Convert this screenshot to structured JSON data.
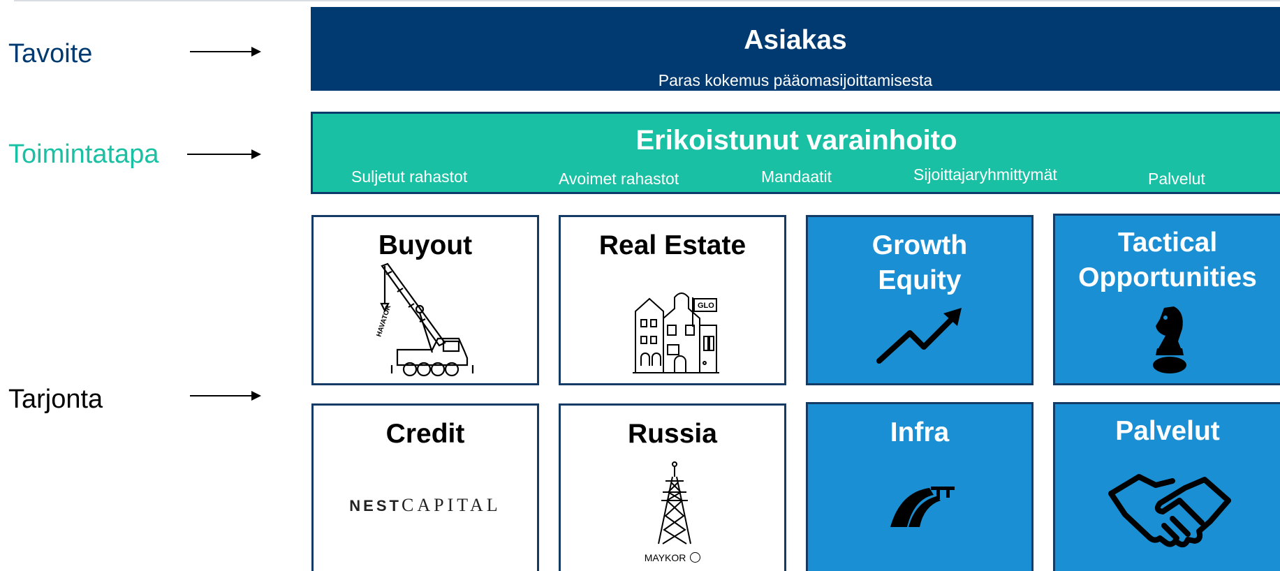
{
  "labels": {
    "tavoite": "Tavoite",
    "toimintatapa": "Toimintatapa",
    "tarjonta": "Tarjonta"
  },
  "colors": {
    "navy": "#003a70",
    "teal": "#19c0a3",
    "blue": "#1b8fd3",
    "border": "#143b66"
  },
  "top_band": {
    "title": "Asiakas",
    "subtitle": "Paras kokemus pääomasijoittamisesta"
  },
  "mid_band": {
    "title": "Erikoistunut varainhoito",
    "items": [
      "Suljetut rahastot",
      "Avoimet rahastot",
      "Mandaatit",
      "Sijoittajaryhmittymät",
      "Palvelut"
    ]
  },
  "offerings": {
    "buyout": {
      "title": "Buyout",
      "icon": "crane-icon",
      "icon_text": "HAVATOR"
    },
    "real_estate": {
      "title": "Real Estate",
      "icon": "building-icon",
      "icon_text": "GLO"
    },
    "growth_equity": {
      "title_1": "Growth",
      "title_2": "Equity",
      "icon": "trend-arrow-icon"
    },
    "tactical": {
      "title_1": "Tactical",
      "title_2": "Opportunities",
      "icon": "chess-knight-icon"
    },
    "credit": {
      "title": "Credit",
      "logo_bold": "NEST",
      "logo_rest": "CAPITAL"
    },
    "russia": {
      "title": "Russia",
      "icon": "power-tower-icon",
      "logo_text": "MAYKOR"
    },
    "infra": {
      "title": "Infra",
      "icon": "road-icon"
    },
    "palvelut": {
      "title": "Palvelut",
      "icon": "handshake-icon"
    }
  }
}
